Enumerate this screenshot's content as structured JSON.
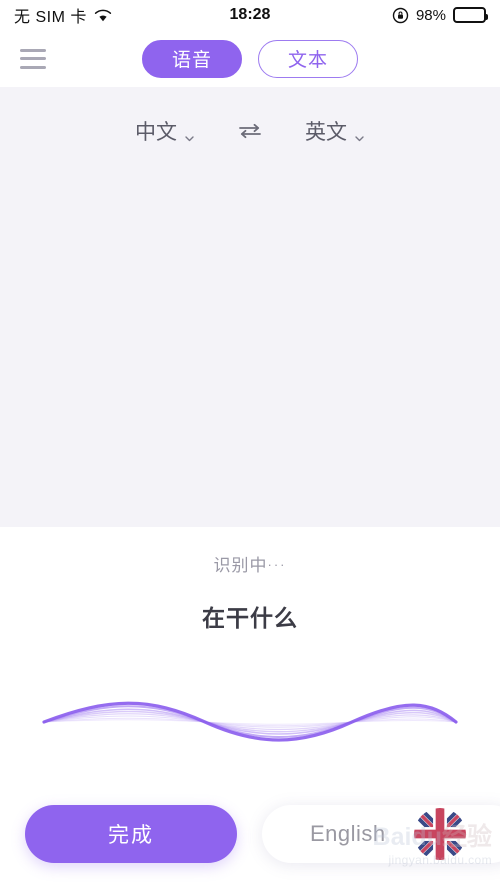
{
  "status_bar": {
    "carrier": "无 SIM 卡",
    "wifi_icon": "wifi-icon",
    "time": "18:28",
    "rotation_lock_icon": "rotation-lock-icon",
    "battery_percent": "98%",
    "battery_icon": "battery-full-icon"
  },
  "nav": {
    "menu_icon": "hamburger-menu-icon",
    "tabs": [
      {
        "label": "语音",
        "active": true
      },
      {
        "label": "文本",
        "active": false
      }
    ]
  },
  "language_bar": {
    "source": {
      "label": "中文",
      "caret_icon": "chevron-down-icon"
    },
    "swap_icon": "swap-arrows-icon",
    "target": {
      "label": "英文",
      "caret_icon": "chevron-down-icon"
    }
  },
  "recognition": {
    "status": "识别中",
    "status_dots": "···",
    "text": "在干什么"
  },
  "waveform": {
    "name": "audio-waveform",
    "color": "#8f64ee"
  },
  "bottom": {
    "done_label": "完成",
    "english_card": {
      "label": "English",
      "flag_icon": "uk-flag-icon"
    }
  },
  "watermark": {
    "brand": "Baidu",
    "brand_cn": "经验",
    "url": "jingyan.baidu.com"
  },
  "colors": {
    "accent_purple": "#8f64ee",
    "panel_bg": "#f4f3f8",
    "text_muted": "#9a99a6",
    "text_dark": "#3c3c46"
  }
}
